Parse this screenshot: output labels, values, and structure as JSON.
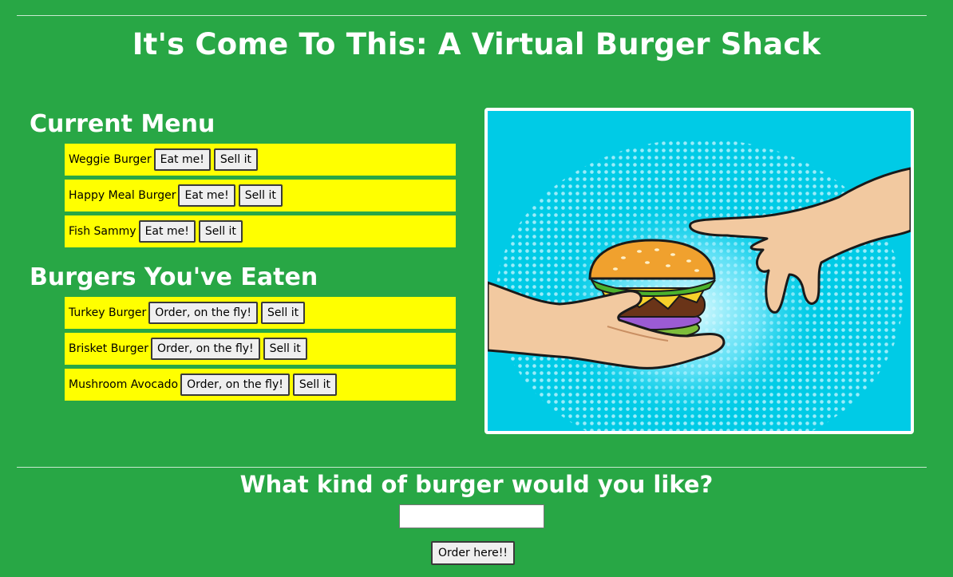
{
  "header": {
    "title": "It's Come To This: A Virtual Burger Shack"
  },
  "menu": {
    "heading": "Current Menu",
    "items": [
      {
        "name": "Weggie Burger",
        "eat_label": "Eat me!",
        "sell_label": "Sell it"
      },
      {
        "name": "Happy Meal Burger",
        "eat_label": "Eat me!",
        "sell_label": "Sell it"
      },
      {
        "name": "Fish Sammy",
        "eat_label": "Eat me!",
        "sell_label": "Sell it"
      }
    ]
  },
  "eaten": {
    "heading": "Burgers You've Eaten",
    "items": [
      {
        "name": "Turkey Burger",
        "order_label": "Order, on the fly!",
        "sell_label": "Sell it"
      },
      {
        "name": "Brisket Burger",
        "order_label": "Order, on the fly!",
        "sell_label": "Sell it"
      },
      {
        "name": "Mushroom Avocado",
        "order_label": "Order, on the fly!",
        "sell_label": "Sell it"
      }
    ]
  },
  "image": {
    "subject": "hands-passing-burger-illustration",
    "background_color": "#00cbe6"
  },
  "order_form": {
    "heading": "What kind of burger would you like?",
    "input_value": "",
    "input_placeholder": "",
    "submit_label": "Order here!!"
  },
  "colors": {
    "page_background": "#28a745",
    "row_background": "#ffff00"
  }
}
